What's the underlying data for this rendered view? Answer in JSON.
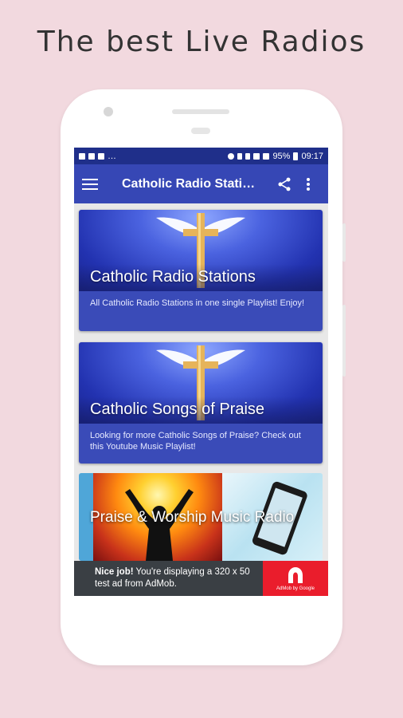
{
  "headline": "The best Live Radios",
  "status_bar": {
    "battery": "95%",
    "time": "09:17"
  },
  "app_bar": {
    "title": "Catholic Radio Stations"
  },
  "cards": [
    {
      "title": "Catholic Radio Stations",
      "description": "All Catholic Radio Stations in one single Playlist! Enjoy!"
    },
    {
      "title": "Catholic Songs of Praise",
      "description": "Looking for more Catholic Songs of Praise? Check out this Youtube Music Playlist!"
    },
    {
      "title": "Praise & Worship Music Radio"
    }
  ],
  "ad": {
    "bold": "Nice job!",
    "text": " You're displaying a 320 x 50 test ad from AdMob.",
    "logo_caption": "AdMob by Google"
  },
  "colors": {
    "background": "#f2d9df",
    "status_bar": "#1f2f8a",
    "app_bar": "#3647b5",
    "card_desc": "#3a4bb8",
    "ad_bg": "#3a3f44",
    "ad_logo": "#ea1d2c"
  },
  "icons": [
    "menu-icon",
    "share-icon",
    "more-vert-icon",
    "cross-with-wings-icon",
    "admob-logo-icon"
  ]
}
